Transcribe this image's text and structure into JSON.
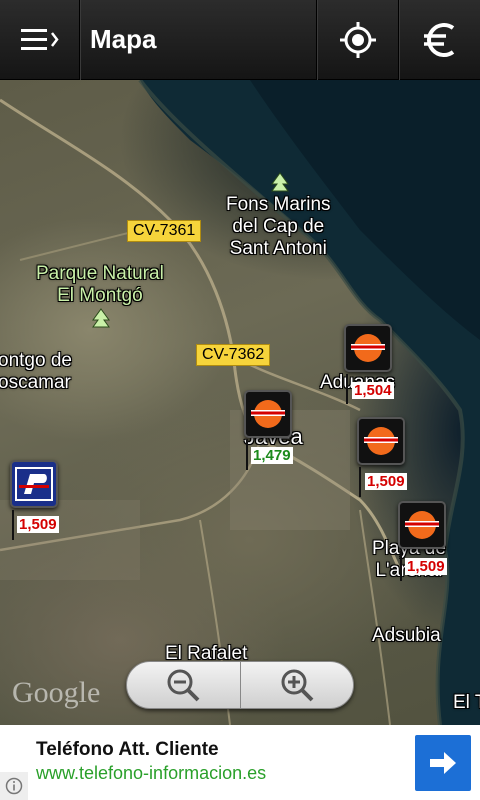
{
  "topbar": {
    "title": "Mapa",
    "icons": [
      "menu-drawer-icon",
      "locate-crosshair-icon",
      "euro-icon"
    ]
  },
  "map": {
    "places": [
      {
        "id": "fons",
        "text": "Fons Marins\ndel Cap de\nSant Antoni"
      },
      {
        "id": "parque",
        "text": "Parque Natural\nEl Montgó"
      },
      {
        "id": "montgo",
        "text": "ontgo de\noscamar"
      },
      {
        "id": "aduanas",
        "text": "Aduanas"
      },
      {
        "id": "javea",
        "text": "Jávea"
      },
      {
        "id": "playa",
        "text": "Playa de\nL'arenal"
      },
      {
        "id": "rafalet",
        "text": "El Rafalet"
      },
      {
        "id": "adsubia",
        "text": "Adsubia"
      },
      {
        "id": "edge",
        "text": "El T"
      }
    ],
    "roads": [
      "CV-7361",
      "CV-7362"
    ],
    "stations": [
      {
        "brand": "repsol",
        "price": "1,504",
        "color": "red"
      },
      {
        "brand": "repsol",
        "price": "1,479",
        "color": "green"
      },
      {
        "brand": "repsol",
        "price": "1,509",
        "color": "red"
      },
      {
        "brand": "repsol",
        "price": "1,509",
        "color": "red"
      },
      {
        "brand": "petronor",
        "price": "1,509",
        "color": "red"
      }
    ],
    "zoom": {
      "out": "zoom-out-icon",
      "in": "zoom-in-icon"
    },
    "attribution": "Google"
  },
  "ad": {
    "title": "Teléfono Att. Cliente",
    "url": "www.telefono-informacion.es",
    "info_icon": "info-icon",
    "arrow_icon": "arrow-right-icon"
  },
  "colors": {
    "accent": "#1c6fd6",
    "price_red": "#d40000",
    "price_green": "#1c8a1c",
    "road_label": "#f6d43b",
    "park_label": "#c9f0a8"
  }
}
